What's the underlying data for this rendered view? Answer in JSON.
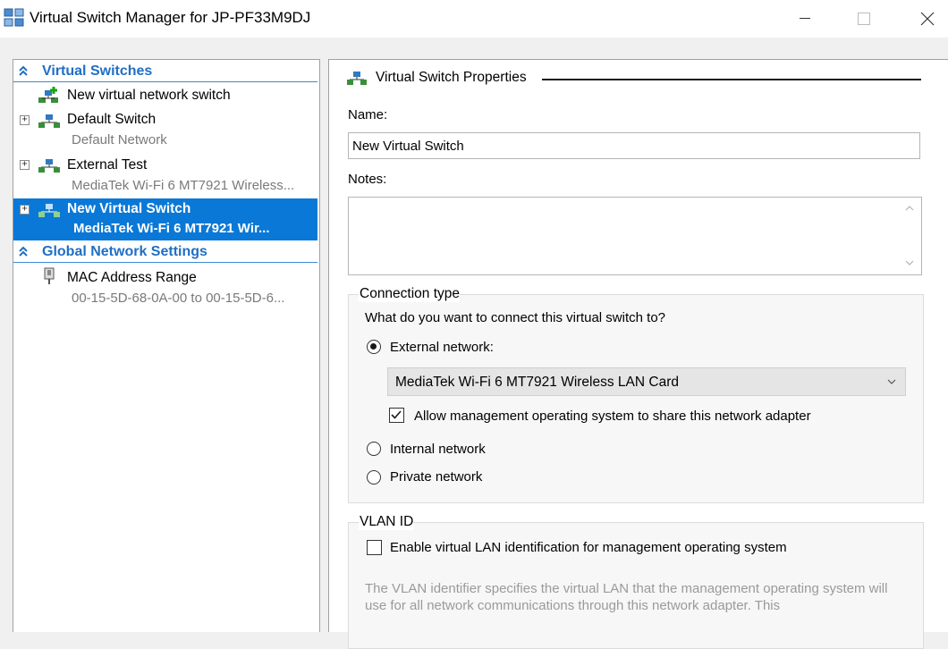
{
  "window": {
    "title": "Virtual Switch Manager for JP-PF33M9DJ"
  },
  "left": {
    "virtual_switches_header": "Virtual Switches",
    "items": [
      {
        "label": "New virtual network switch"
      },
      {
        "label": "Default Switch",
        "sub": "Default Network"
      },
      {
        "label": "External Test",
        "sub": "MediaTek Wi-Fi 6 MT7921 Wireless..."
      },
      {
        "label": "New Virtual Switch",
        "sub": "MediaTek Wi-Fi 6 MT7921 Wir..."
      }
    ],
    "global_header": "Global Network Settings",
    "mac": {
      "label": "MAC Address Range",
      "sub": "00-15-5D-68-0A-00 to 00-15-5D-6..."
    }
  },
  "props": {
    "title": "Virtual Switch Properties",
    "name_label": "Name:",
    "name_value": "New Virtual Switch",
    "notes_label": "Notes:",
    "connection": {
      "title": "Connection type",
      "question": "What do you want to connect this virtual switch to?",
      "external": "External network:",
      "adapter": "MediaTek Wi-Fi 6 MT7921 Wireless LAN Card",
      "allow_mgmt": "Allow management operating system to share this network adapter",
      "internal": "Internal network",
      "private": "Private network",
      "selected": "External network:",
      "allow_mgmt_checked": true
    },
    "vlan": {
      "title": "VLAN ID",
      "enable": "Enable virtual LAN identification for management operating system",
      "enable_checked": false,
      "help": "The VLAN identifier specifies the virtual LAN that the management operating system will use for all network communications through this network adapter. This"
    }
  },
  "colors": {
    "accent": "#0a78d7",
    "header_text": "#1f6fc5"
  }
}
